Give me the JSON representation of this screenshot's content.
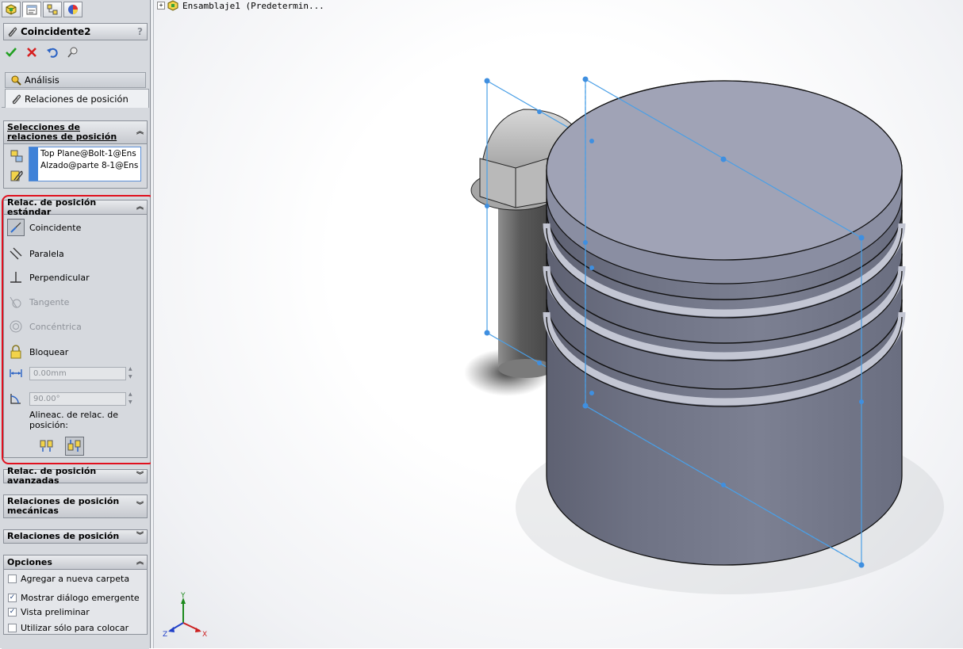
{
  "panel": {
    "tabs": [
      "FeatureManager",
      "PropertyManager",
      "ConfigurationManager",
      "DisplayManager"
    ],
    "title": "Coincidente2",
    "help": "?",
    "actions": [
      "ok",
      "cancel",
      "undo",
      "pin"
    ],
    "subtabs": {
      "analysis": "Análisis",
      "mates": "Relaciones de posición"
    },
    "selections": {
      "header": "Selecciones de relaciones de posición",
      "items": [
        "Top Plane@Bolt-1@Ens",
        "Alzado@parte 8-1@Ens"
      ]
    },
    "standard": {
      "header": "Relac. de posición estándar",
      "items": [
        {
          "label": "Coincidente",
          "state": "selected"
        },
        {
          "label": "Paralela",
          "state": "enabled"
        },
        {
          "label": "Perpendicular",
          "state": "enabled"
        },
        {
          "label": "Tangente",
          "state": "disabled"
        },
        {
          "label": "Concéntrica",
          "state": "disabled"
        },
        {
          "label": "Bloquear",
          "state": "enabled"
        }
      ],
      "distance": "0.00mm",
      "angle": "90.00°",
      "alignment_label": "Alineac. de relac. de posición:"
    },
    "advanced_header": "Relac. de posición avanzadas",
    "mechanical_header": "Relaciones de posición mecánicas",
    "mates_header": "Relaciones de posición",
    "options": {
      "header": "Opciones",
      "items": [
        {
          "label": "Agregar a nueva carpeta",
          "checked": false
        },
        {
          "label": "Mostrar diálogo emergente",
          "checked": true
        },
        {
          "label": "Vista preliminar",
          "checked": true
        },
        {
          "label": "Utilizar sólo para colocar",
          "checked": false
        }
      ]
    }
  },
  "viewport": {
    "tree_label": "Ensamblaje1  (Predetermin...",
    "triad": {
      "x": "X",
      "y": "Y",
      "z": "Z"
    }
  },
  "colors": {
    "accent": "#3f82d8",
    "highlight": "#e0101e",
    "plane": "#4a9fe6",
    "part": "#8b8fa0"
  }
}
